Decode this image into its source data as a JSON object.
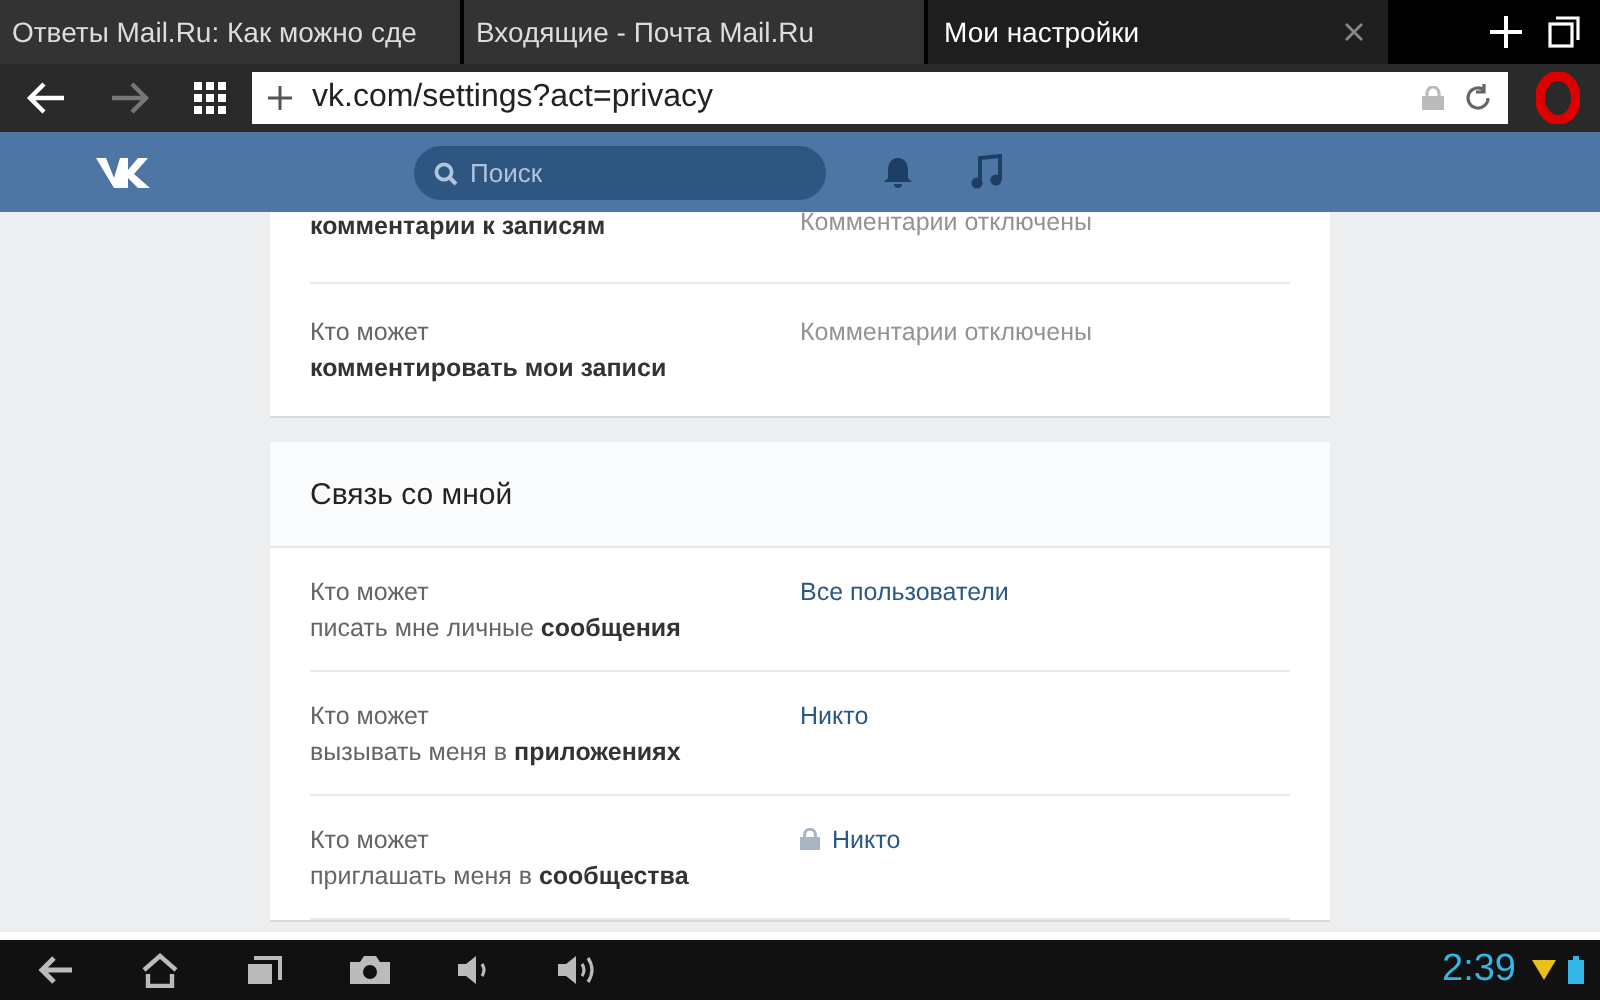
{
  "browser_tabs": [
    {
      "title": "Ответы Mail.Ru: Как можно сде",
      "selected": false
    },
    {
      "title": "Входящие - Почта Mail.Ru",
      "selected": false
    },
    {
      "title": "Мои настройки",
      "selected": true
    }
  ],
  "address_bar": {
    "url": "vk.com/settings?act=privacy"
  },
  "header": {
    "search_placeholder": "Поиск"
  },
  "sections": [
    {
      "rows": [
        {
          "label_top": null,
          "label": "комментарии к записям",
          "value": "Комментарии отключены",
          "kind": "muted",
          "locked": false
        },
        {
          "label_top": "Кто может",
          "label": "**комментировать мои записи**",
          "value": "Комментарии отключены",
          "kind": "muted",
          "locked": false
        }
      ]
    },
    {
      "title": "Связь со мной",
      "rows": [
        {
          "label_top": "Кто может",
          "label": "писать мне личные **сообщения**",
          "value": "Все пользователи",
          "kind": "link",
          "locked": false
        },
        {
          "label_top": "Кто может",
          "label": "вызывать меня в **приложениях**",
          "value": "Никто",
          "kind": "link",
          "locked": false
        },
        {
          "label_top": "Кто может",
          "label": "приглашать меня в **сообщества**",
          "value": "Никто",
          "kind": "link",
          "locked": true
        }
      ]
    }
  ],
  "taskbar": {
    "time": "2:39"
  }
}
